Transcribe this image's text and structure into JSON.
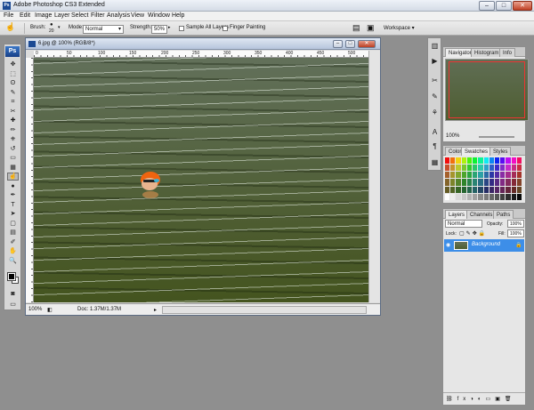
{
  "app": {
    "title": "Adobe Photoshop CS3 Extended",
    "logo": "Ps",
    "window_controls": [
      "–",
      "□",
      "✕"
    ]
  },
  "menu": [
    "File",
    "Edit",
    "Image",
    "Layer",
    "Select",
    "Filter",
    "Analysis",
    "View",
    "Window",
    "Help"
  ],
  "options_bar": {
    "brush_label": "Brush:",
    "brush_size": "20",
    "mode_label": "Mode:",
    "mode_value": "Normal",
    "strength_label": "Strength:",
    "strength_value": "50%",
    "sample_all_layers": "Sample All Layers",
    "finger_painting": "Finger Painting",
    "workspace": "Workspace ▾"
  },
  "toolbox": {
    "icons": [
      "move-icon",
      "marquee-icon",
      "lasso-icon",
      "quick-select-icon",
      "crop-icon",
      "slice-icon",
      "healing-icon",
      "brush-icon",
      "clone-stamp-icon",
      "history-brush-icon",
      "eraser-icon",
      "gradient-icon",
      "smudge-icon",
      "dodge-icon",
      "pen-icon",
      "type-icon",
      "path-select-icon",
      "shape-icon",
      "notes-icon",
      "eyedropper-icon",
      "hand-icon",
      "zoom-icon"
    ],
    "glyphs": [
      "✥",
      "⬚",
      "ʘ",
      "✎",
      "⌗",
      "✂",
      "✚",
      "✏",
      "⎈",
      "↺",
      "▭",
      "▦",
      "☝",
      "●",
      "✒",
      "T",
      "➤",
      "▢",
      "▤",
      "✐",
      "✋",
      "🔍"
    ],
    "active_index": 12
  },
  "document": {
    "title": "6.jpg @ 100% (RGB/8*)",
    "ruler_marks": [
      "0",
      "50",
      "100",
      "150",
      "200",
      "250",
      "300",
      "350",
      "400",
      "450",
      "500"
    ],
    "zoom": "100%",
    "doc_info": "Doc: 1.37M/1.37M"
  },
  "panels": {
    "navigator_tabs": [
      "Navigator",
      "Histogram",
      "Info"
    ],
    "navigator_zoom": "100%",
    "swatch_tabs": [
      "Color",
      "Swatches",
      "Styles"
    ],
    "layers_tabs": [
      "Layers",
      "Channels",
      "Paths"
    ],
    "blend_mode": "Normal",
    "opacity_label": "Opacity:",
    "opacity": "100%",
    "lock_label": "Lock:",
    "fill_label": "Fill:",
    "fill": "100%",
    "layer_name": "Background"
  },
  "colors": {
    "accent": "#3d8ee8",
    "layer_selected": "#3d8ee8"
  }
}
